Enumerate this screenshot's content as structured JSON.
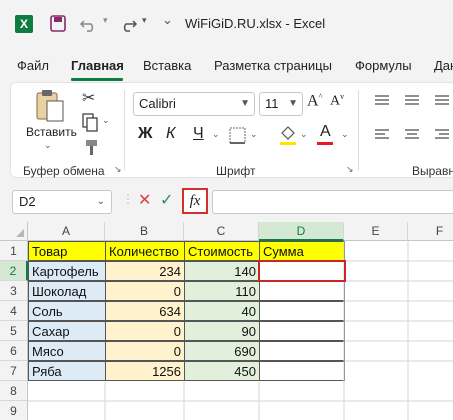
{
  "titlebar": {
    "app_icon": "excel-icon",
    "save_icon": "save-icon",
    "undo_icon": "undo-icon",
    "redo_icon": "redo-icon",
    "qa_more_icon": "chevron-down-icon",
    "title": "WiFiGiD.RU.xlsx  -  Excel"
  },
  "menu": {
    "tabs": [
      "Файл",
      "Главная",
      "Вставка",
      "Разметка страницы",
      "Формулы",
      "Дан"
    ],
    "active": "Главная"
  },
  "ribbon": {
    "clipboard": {
      "paste_label": "Вставить",
      "group_label": "Буфер обмена",
      "cut_icon": "scissors-icon",
      "copy_icon": "copy-icon",
      "format_painter_icon": "brush-icon"
    },
    "font": {
      "font_name": "Calibri",
      "font_size": "11",
      "group_label": "Шрифт",
      "bold": "Ж",
      "italic": "К",
      "underline": "Ч",
      "font_color_letter": "A",
      "grow_letter": "A",
      "shrink_letter": "A",
      "fill_icon": "paint-bucket-icon",
      "borders_icon": "borders-icon"
    },
    "alignment": {
      "group_label": "Выравн"
    }
  },
  "formula_bar": {
    "name_box": "D2",
    "cancel_icon": "close-icon",
    "enter_icon": "check-icon",
    "fx_label": "fx",
    "formula_value": ""
  },
  "sheet": {
    "columns": [
      "A",
      "B",
      "C",
      "D",
      "E",
      "F"
    ],
    "rows": [
      "1",
      "2",
      "3",
      "4",
      "5",
      "6",
      "7",
      "8",
      "9"
    ],
    "header": [
      "Товар",
      "Количество",
      "Стоимость",
      "Сумма"
    ],
    "data": [
      [
        "Картофель",
        "234",
        "140"
      ],
      [
        "Шоколад",
        "0",
        "110"
      ],
      [
        "Соль",
        "634",
        "40"
      ],
      [
        "Сахар",
        "0",
        "90"
      ],
      [
        "Мясо",
        "0",
        "690"
      ],
      [
        "Ряба",
        "1256",
        "450"
      ]
    ],
    "selected_cell": "D2",
    "colors": {
      "header_fill": "#ffff00",
      "col_a_fill": "#ddebf7",
      "col_b_fill": "#fff2cc",
      "col_c_fill": "#e2efda",
      "selection_outline": "#c62828",
      "excel_green": "#107c41"
    }
  }
}
